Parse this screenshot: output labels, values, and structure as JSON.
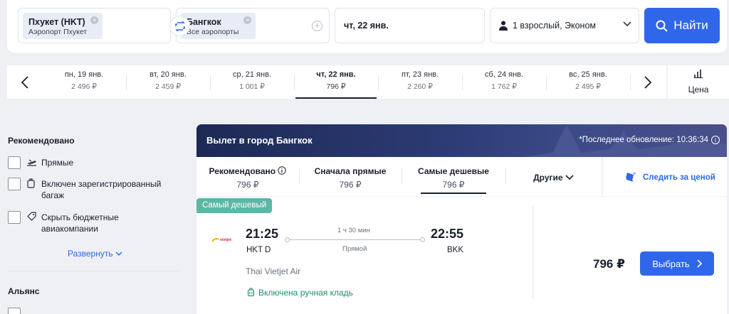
{
  "search": {
    "origin_code": "Пхукет (HKT)",
    "origin_sub": "Аэропорт Пхукет",
    "dest_code": "Бангкок",
    "dest_sub": "Все аэропорты",
    "date": "чт, 22 янв.",
    "passengers": "1 взрослый, Эконом",
    "find_label": "Найти"
  },
  "dates": [
    {
      "day": "пн, 19 янв.",
      "price": "2 496 ₽"
    },
    {
      "day": "вт, 20 янв.",
      "price": "2 459 ₽"
    },
    {
      "day": "ср, 21 янв.",
      "price": "1 001 ₽"
    },
    {
      "day": "чт, 22 янв.",
      "price": "796 ₽",
      "selected": true
    },
    {
      "day": "пт, 23 янв.",
      "price": "2 260 ₽"
    },
    {
      "day": "сб, 24 янв.",
      "price": "1 762 ₽"
    },
    {
      "day": "вс, 25 янв.",
      "price": "2 495 ₽"
    }
  ],
  "price_tab_label": "Цена",
  "sidebar": {
    "recommended_title": "Рекомендовано",
    "options": [
      {
        "label": "Прямые",
        "icon": "plane-icon"
      },
      {
        "label": "Включен зарегистрированный багаж",
        "icon": "luggage-icon"
      },
      {
        "label": "Скрыть бюджетные авиакомпании",
        "icon": "tag-icon"
      }
    ],
    "expand_label": "Развернуть",
    "alliance_title": "Альянс"
  },
  "banner": {
    "title": "Вылет в город Бангкок",
    "updated": "*Последнее обновление: 10:36:34"
  },
  "sort_tabs": [
    {
      "name": "Рекомендовано",
      "value": "796 ₽"
    },
    {
      "name": "Сначала прямые",
      "value": "796 ₽"
    },
    {
      "name": "Самые дешевые",
      "value": "796 ₽",
      "active": true
    }
  ],
  "other_label": "Другие",
  "follow_label": "Следить за ценой",
  "flight": {
    "badge": "Самый дешевый",
    "airline_logo_text": "vietjet",
    "depart_time": "21:25",
    "depart_airport": "HKT D",
    "arrive_time": "22:55",
    "arrive_airport": "BKK",
    "duration": "1 ч 30 мин",
    "stops": "Прямой",
    "airline": "Thai Vietjet Air",
    "baggage": "Включена ручная кладь",
    "price": "796 ₽",
    "select_label": "Выбрать"
  },
  "colors": {
    "accent": "#2f66ea",
    "badge": "#5db7a6",
    "baggage": "#1a8f6e"
  }
}
